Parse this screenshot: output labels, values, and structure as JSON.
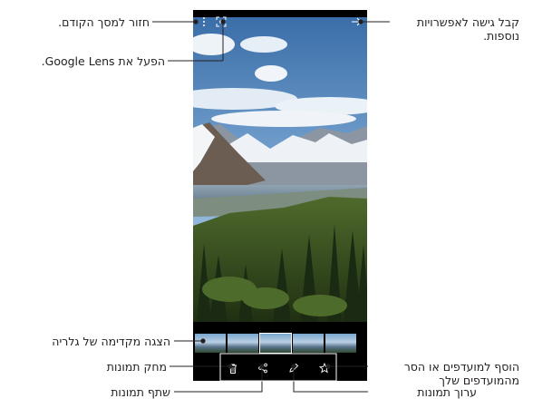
{
  "labels": {
    "back": "חזור למסך הקודם.",
    "lens": "הפעל את Google Lens.",
    "more_options_line1": "קבל גישה לאפשרויות",
    "more_options_line2": "נוספות.",
    "gallery_preview": "הצגה מקדימה של גלריה",
    "delete": "מחק תמונות",
    "favorites_line1": "הוסף למועדפים או הסר",
    "favorites_line2": "מהמועדפים שלך",
    "share": "שתף תמונות",
    "edit": "ערוך תמונות"
  },
  "icons": {
    "top_left": "more-options-icon",
    "lens": "google-lens-icon",
    "top_right": "back-arrow-icon",
    "delete": "trash-icon",
    "share": "share-icon",
    "edit": "pencil-icon",
    "favorite": "star-icon"
  },
  "colors": {
    "callout_line": "#231f20",
    "toolbar_outline": "#ffffff",
    "phone_frame": "#000000"
  }
}
